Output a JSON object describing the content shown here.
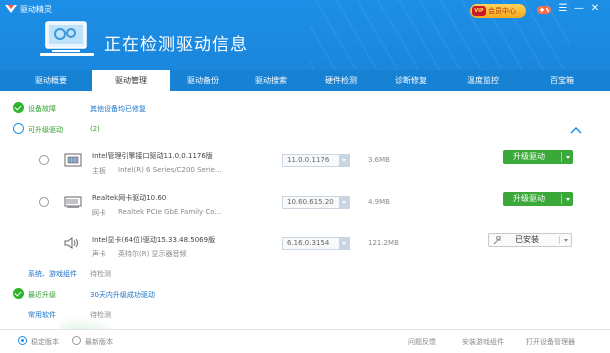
{
  "app": {
    "name": "驱动精灵",
    "title": "正在检测驱动信息"
  },
  "header": {
    "vip_mark": "VIP",
    "vip_label": "会员中心",
    "window_buttons": [
      "☰",
      "—",
      "✕"
    ]
  },
  "tabs": [
    "驱动概要",
    "驱动管理",
    "驱动备份",
    "驱动搜索",
    "硬件检测",
    "诊断修复",
    "温度监控",
    "百宝箱"
  ],
  "sections": {
    "installed": {
      "label": "设备故障",
      "link": "其他设备均已修复"
    },
    "upgradable": {
      "label": "可升级驱动",
      "count": "(2)"
    },
    "system": {
      "label": "系统、游戏组件",
      "value": "待检测"
    },
    "latest": {
      "label": "最近升级",
      "link": "30天内升级成功驱动"
    },
    "common": {
      "label": "常用软件",
      "value": "待检测"
    }
  },
  "drivers": [
    {
      "name": "Intel管理引擎接口驱动11.0.0.1176版",
      "type_label": "主板",
      "device": "Intel(R) 6 Series/C200 Serie...",
      "version": "11.0.0.1176",
      "size": "3.6MB",
      "action": "升级驱动",
      "icon": "chip-icon"
    },
    {
      "name": "Realtek网卡驱动10.60",
      "type_label": "网卡",
      "device": "Realtek PCIe GbE Family Co...",
      "version": "10.60.615.20",
      "size": "4.9MB",
      "action": "升级驱动",
      "icon": "network-card-icon"
    },
    {
      "name": "Intel显卡(64位)驱动15.33.48.5069版",
      "type_label": "声卡",
      "device": "英特尔(R) 显示器音频",
      "version": "6.16.0.3154",
      "size": "121.2MB",
      "action": "已安装",
      "icon": "speaker-icon"
    }
  ],
  "footer": {
    "options": [
      "稳定版本",
      "最新版本"
    ],
    "links": [
      "问题反馈",
      "安装游戏组件",
      "打开设备管理器"
    ]
  },
  "colors": {
    "header_blue": "#1d8fe6",
    "tab_blue": "#1781d4",
    "upgrade_green": "#3aa93a",
    "link_blue": "#1a73c9"
  }
}
